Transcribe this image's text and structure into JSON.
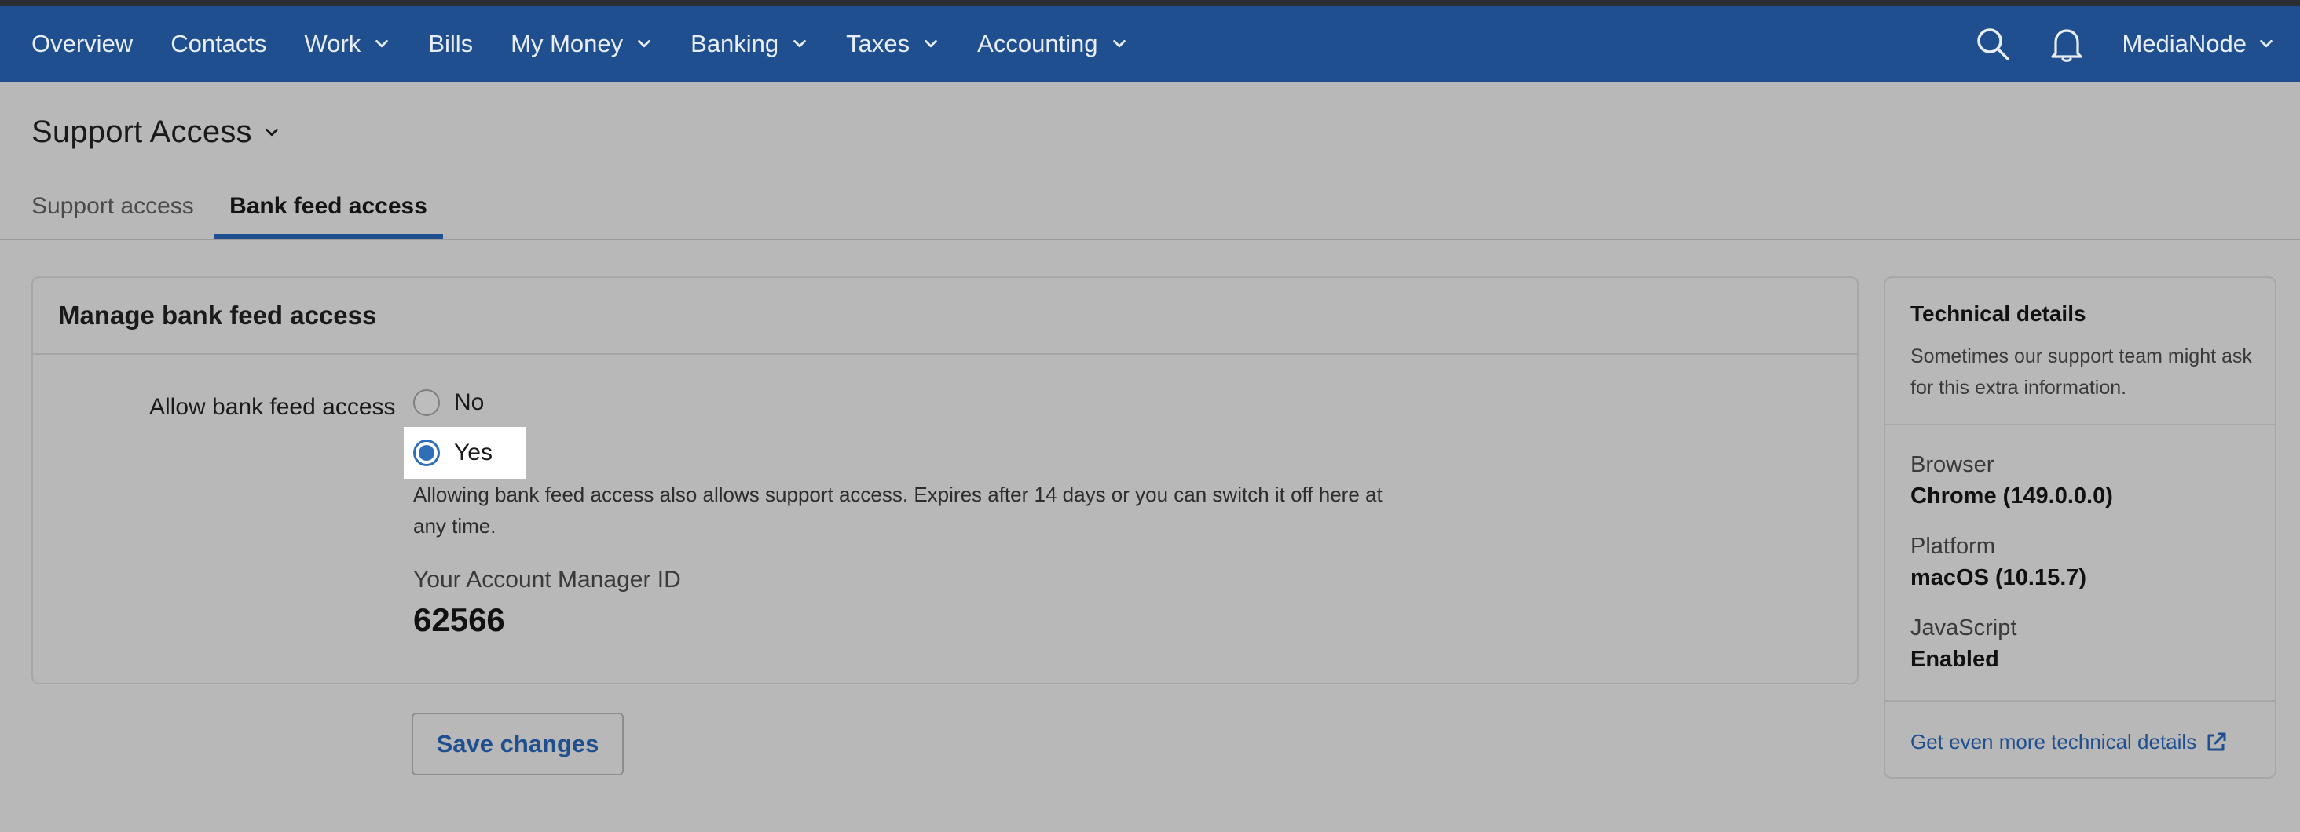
{
  "colors": {
    "nav_bg": "#1f4f8f",
    "accent": "#2f6fb8",
    "page_bg": "#b8b8b8",
    "link": "#1f4f8f"
  },
  "nav": {
    "items": [
      {
        "label": "Overview",
        "has_dropdown": false
      },
      {
        "label": "Contacts",
        "has_dropdown": false
      },
      {
        "label": "Work",
        "has_dropdown": true
      },
      {
        "label": "Bills",
        "has_dropdown": false
      },
      {
        "label": "My Money",
        "has_dropdown": true
      },
      {
        "label": "Banking",
        "has_dropdown": true
      },
      {
        "label": "Taxes",
        "has_dropdown": true
      },
      {
        "label": "Accounting",
        "has_dropdown": true
      }
    ],
    "icons": [
      "search-icon",
      "bell-icon"
    ],
    "user_label": "MediaNode"
  },
  "page": {
    "title": "Support Access"
  },
  "tabs": [
    {
      "label": "Support access",
      "active": false
    },
    {
      "label": "Bank feed access",
      "active": true
    }
  ],
  "panel": {
    "title": "Manage bank feed access",
    "field_label": "Allow bank feed access",
    "options": [
      {
        "label": "No",
        "selected": false
      },
      {
        "label": "Yes",
        "selected": true
      }
    ],
    "help_text": "Allowing bank feed access also allows support access. Expires after 14 days or you can switch it off here at any time.",
    "manager_label": "Your Account Manager ID",
    "manager_id": "62566"
  },
  "actions": {
    "save_label": "Save changes"
  },
  "technical": {
    "title": "Technical details",
    "description": "Sometimes our support team might ask for this extra information.",
    "rows": [
      {
        "key": "Browser",
        "value": "Chrome (149.0.0.0)"
      },
      {
        "key": "Platform",
        "value": "macOS (10.15.7)"
      },
      {
        "key": "JavaScript",
        "value": "Enabled"
      }
    ],
    "link_label": "Get even more technical details",
    "link_icon": "external-link-icon"
  }
}
